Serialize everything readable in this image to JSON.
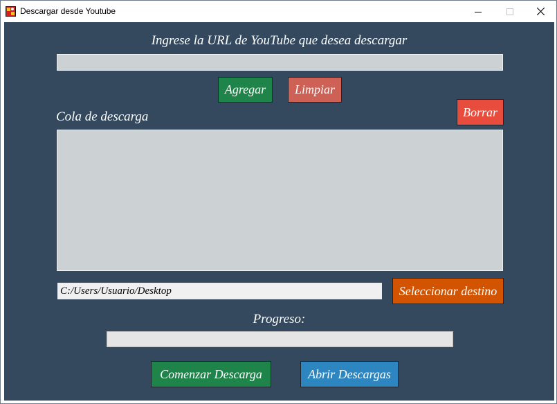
{
  "window": {
    "title": "Descargar desde Youtube",
    "icon": "app-flag-icon"
  },
  "colors": {
    "background": "#34495e",
    "green": "#1e8449",
    "light_red": "#cd6155",
    "red": "#e74c3c",
    "orange": "#d35400",
    "blue": "#2e86c1"
  },
  "url_section": {
    "label": "Ingrese la URL de YouTube que desea descargar",
    "value": ""
  },
  "buttons": {
    "add": "Agregar",
    "clear": "Limpiar",
    "delete": "Borrar",
    "select_dest": "Seleccionar destino",
    "start": "Comenzar Descarga",
    "open": "Abrir Descargas"
  },
  "queue": {
    "label": "Cola de descarga",
    "items": []
  },
  "destination": {
    "path": "C:/Users/Usuario/Desktop"
  },
  "progress": {
    "label": "Progreso:",
    "value": 0
  }
}
